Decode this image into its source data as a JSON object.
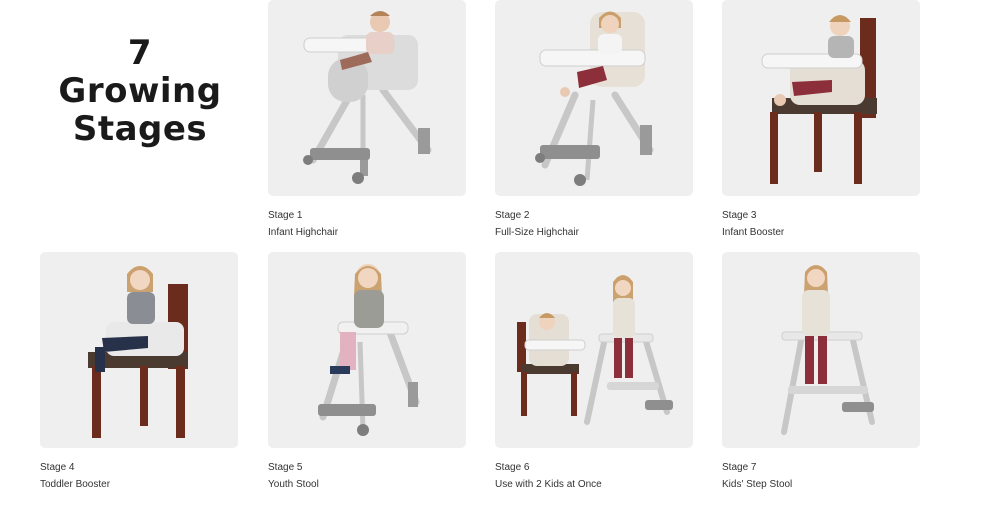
{
  "headline": {
    "line1": "7",
    "line2": "Growing",
    "line3": "Stages"
  },
  "colors": {
    "card_bg": "#efefef",
    "chair_grey": "#b9b9b9",
    "wood": "#6b2c1d",
    "text": "#333333"
  },
  "stages": [
    {
      "stage": "Stage 1",
      "name": "Infant Highchair"
    },
    {
      "stage": "Stage 2",
      "name": "Full-Size Highchair"
    },
    {
      "stage": "Stage 3",
      "name": "Infant Booster"
    },
    {
      "stage": "Stage 4",
      "name": "Toddler Booster"
    },
    {
      "stage": "Stage 5",
      "name": "Youth Stool"
    },
    {
      "stage": "Stage 6",
      "name": "Use with 2 Kids at Once"
    },
    {
      "stage": "Stage 7",
      "name": "Kids' Step Stool"
    }
  ]
}
